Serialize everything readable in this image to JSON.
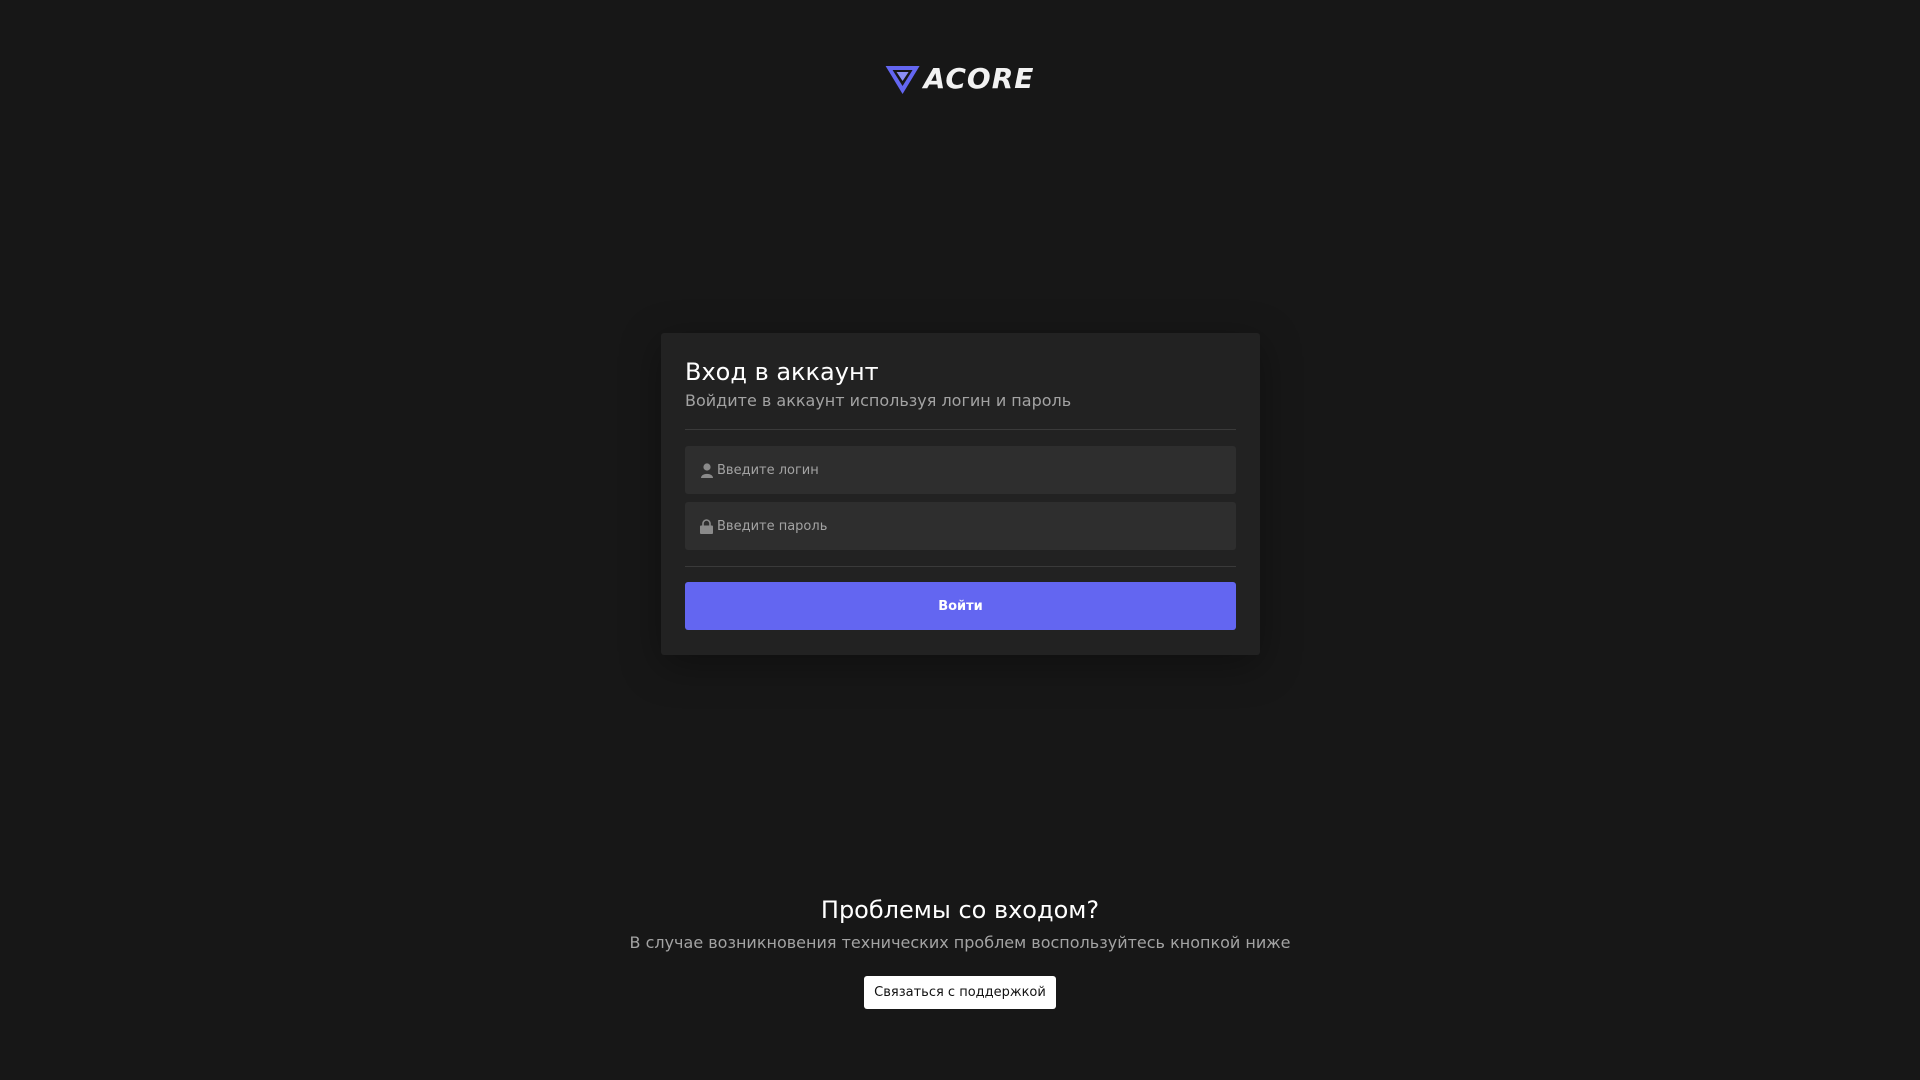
{
  "logo": {
    "text": "ACORE",
    "icon": "triangle-logo-icon",
    "accent": "#6366f1"
  },
  "login_card": {
    "title": "Вход в аккаунт",
    "subtitle": "Войдите в аккаунт используя логин и пароль",
    "login_field": {
      "placeholder": "Введите логин",
      "value": "",
      "icon": "user-icon"
    },
    "password_field": {
      "placeholder": "Введите пароль",
      "value": "",
      "icon": "lock-icon"
    },
    "submit_label": "Войти"
  },
  "help": {
    "title": "Проблемы со входом?",
    "text": "В случае возникновения технических проблем воспользуйтесь кнопкой ниже",
    "button_label": "Связаться с поддержкой"
  },
  "colors": {
    "background": "#171717",
    "card": "#222222",
    "input": "#2e2e2e",
    "primary": "#6366f1"
  }
}
